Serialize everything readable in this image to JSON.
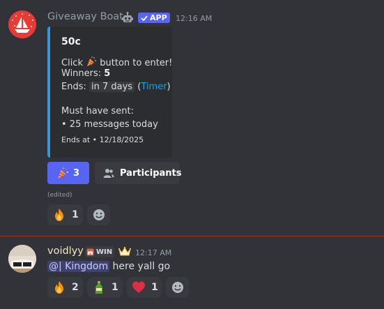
{
  "message1": {
    "author": "Giveaway Boat",
    "app_badge": "APP",
    "time": "12:16 AM",
    "embed": {
      "title": "50c",
      "click_prefix": "Click",
      "click_suffix": "button to enter!",
      "winners_label": "Winners:",
      "winners_value": "5",
      "ends_label": "Ends:",
      "ends_value": "in 7 days",
      "timer_link": "Timer",
      "requirement_heading": "Must have sent:",
      "requirement_item": "• 25 messages today",
      "footer": "Ends at • 12/18/2025",
      "accent_color": "#3498db"
    },
    "buttons": {
      "enter_count": "3",
      "participants_label": "Participants"
    },
    "edited_label": "(edited)",
    "reactions": [
      {
        "icon": "fire-emoji",
        "count": "1"
      }
    ]
  },
  "message2": {
    "author": "voidlyy",
    "role_tag": "WIN",
    "time": "12:17 AM",
    "mention": "@| Kingdom",
    "text": " here yall go",
    "reactions": [
      {
        "icon": "fire-emoji",
        "count": "2"
      },
      {
        "icon": "bottle-emoji",
        "count": "1"
      },
      {
        "icon": "heart-emoji",
        "count": "1"
      }
    ]
  },
  "colors": {
    "background": "#323339",
    "blurple": "#5865f2",
    "divider": "#a12d34",
    "link": "#00a8fc"
  }
}
